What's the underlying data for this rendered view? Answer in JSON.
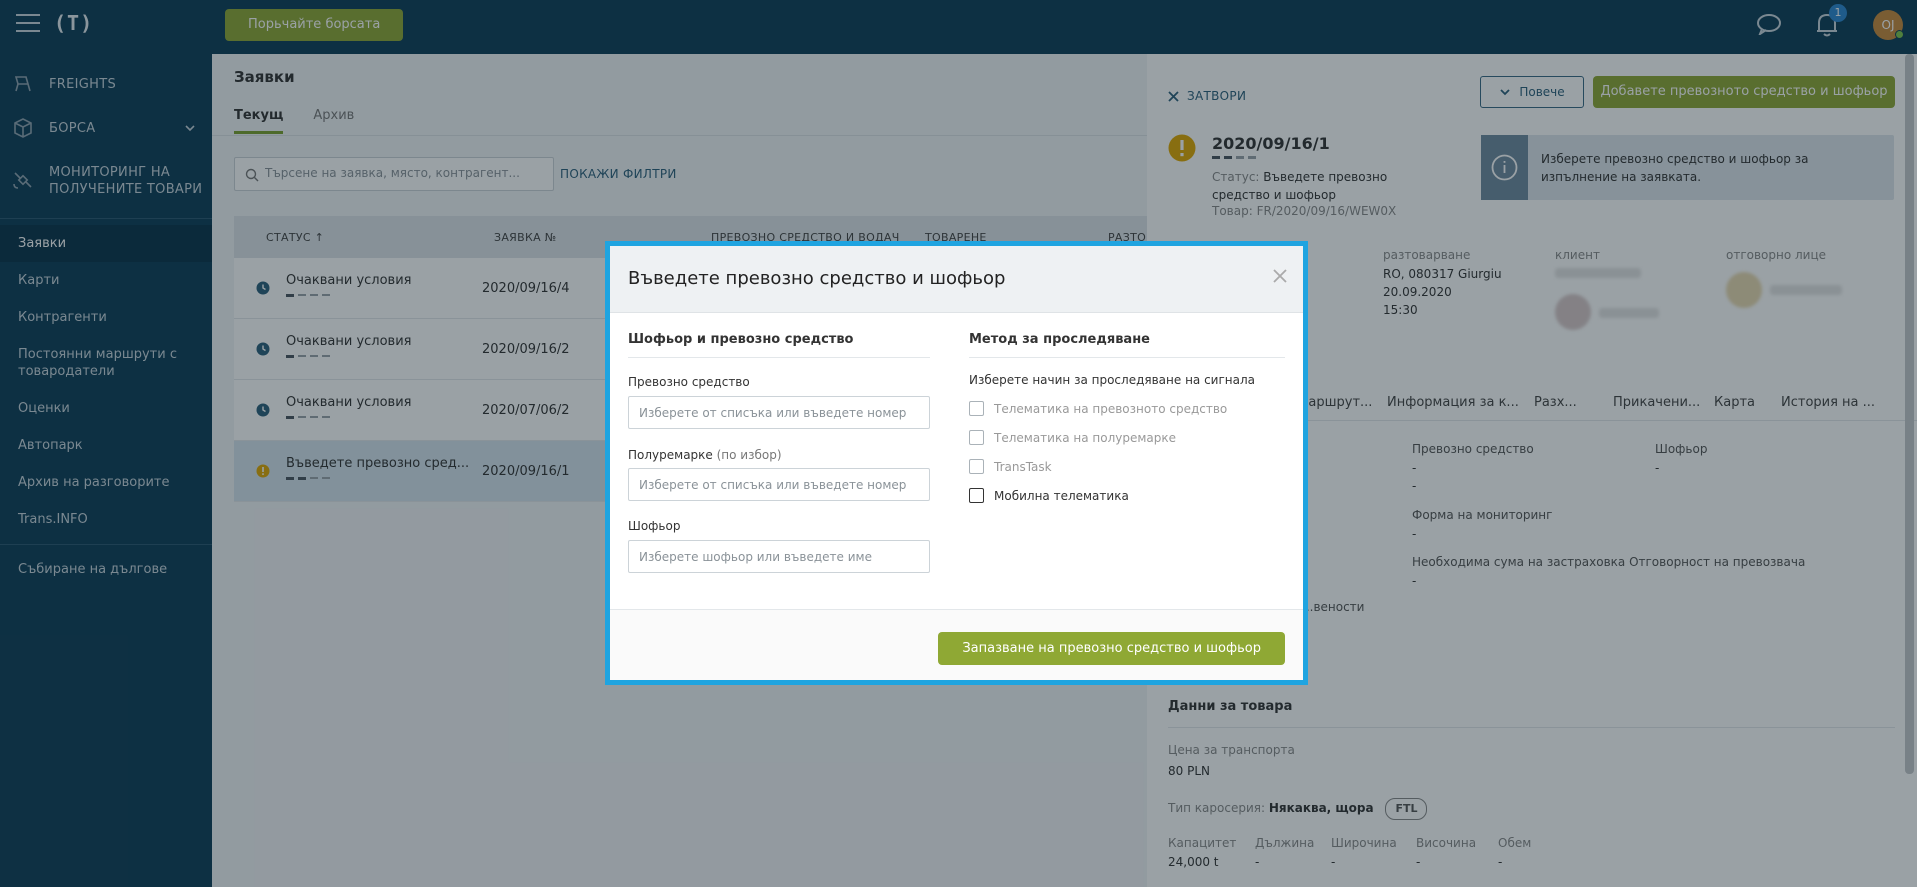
{
  "topbar": {
    "logo": "(T)",
    "browse_button": "Порьчайте борсата",
    "notifications_count": "1",
    "avatar_initials": "OJ"
  },
  "sidebar": {
    "sections": [
      {
        "label": "FREIGHTS",
        "icon": "freights-icon"
      },
      {
        "label": "БОРСА",
        "icon": "box-icon"
      },
      {
        "label": "МОНИТОРИНГ НА ПОЛУЧЕНИТЕ ТОВАРИ",
        "icon": "satellite-icon"
      }
    ],
    "items": [
      {
        "label": "Заявки",
        "active": true
      },
      {
        "label": "Карти"
      },
      {
        "label": "Контрагенти"
      },
      {
        "label": "Постоянни маршрути с товародатели"
      },
      {
        "label": "Оценки"
      },
      {
        "label": "Автопарк"
      },
      {
        "label": "Архив на разговорите"
      },
      {
        "label": "Trans.INFO"
      },
      {
        "label": "Събиране на дългове"
      }
    ]
  },
  "main": {
    "title": "Заявки",
    "tabs": [
      {
        "label": "Текущ"
      },
      {
        "label": "Архив"
      }
    ],
    "search_placeholder": "Търсене на заявка, място, контрагент...",
    "filters_label": "ПОКАЖИ ФИЛТРИ",
    "columns": [
      "СТАТУС ↑",
      "ЗАЯВКА №",
      "ПРЕВОЗНО СРЕДСТВО И ВОДАЧ",
      "ТОВАРЕНЕ",
      "РАЗТОВ"
    ],
    "rows": [
      {
        "status": "Очаквани условия",
        "number": "2020/09/16/4"
      },
      {
        "status": "Очаквани условия",
        "number": "2020/09/16/2"
      },
      {
        "status": "Очаквани условия",
        "number": "2020/07/06/2"
      },
      {
        "status": "Въведете превозно сред...",
        "number": "2020/09/16/1"
      }
    ]
  },
  "panel": {
    "close_label": "ЗАТВОРИ",
    "more_label": "Повече",
    "add_button": "Добавете превозното средство и шофьор",
    "order_number": "2020/09/16/1",
    "status_label": "Статус:",
    "status_value": "Въведете превозно средство и шофьор",
    "goods_label": "Товар:",
    "goods_value": "FR/2020/09/16/WEW0X",
    "info_text": "Изберете превозно средство и шофьор за изпълнение на заявката.",
    "unloading_label": "разтоварване",
    "unloading_place": "RO, 080317 Giurgiu",
    "unloading_date": "20.09.2020",
    "unloading_time": "15:30",
    "client_label": "клиент",
    "responsible_label": "отговорно лице",
    "tabs": [
      "...аршрут...",
      "Информация за к...",
      "Разх...",
      "Прикачени...",
      "Карта",
      "История на ..."
    ],
    "vehicle_label": "Превозно средство",
    "vehicle_value": "-",
    "vehicle_value2": "-",
    "driver_label": "Шофьор",
    "driver_value": "-",
    "monitoring_label": "Форма на мониторинг",
    "monitoring_value": "-",
    "insurance_label": "Необходима сума на застраховка Отговорност на превозвача",
    "insurance_value": "-",
    "partial_label": "...вености",
    "goods_section": "Данни за товара",
    "price_label": "Цена за транспорта",
    "price_value": "80 PLN",
    "body_label": "Тип каросерия:",
    "body_value": "Някаква, щора",
    "ftl": "FTL",
    "dims": [
      {
        "label": "Капацитет",
        "value": "24,000 t"
      },
      {
        "label": "Дължина",
        "value": "-"
      },
      {
        "label": "Широчина",
        "value": "-"
      },
      {
        "label": "Височина",
        "value": "-"
      },
      {
        "label": "Обем",
        "value": "-"
      }
    ]
  },
  "modal": {
    "title": "Въведете превозно средство и шофьор",
    "left_title": "Шофьор и превозно средство",
    "vehicle_label": "Превозно средство",
    "vehicle_placeholder": "Изберете от списъка или въведете номер",
    "trailer_label": "Полуремарке",
    "trailer_optional": "(по избор)",
    "trailer_placeholder": "Изберете от списъка или въведете номер",
    "driver_label": "Шофьор",
    "driver_placeholder": "Изберете шофьор или въведете име",
    "right_title": "Метод за проследяване",
    "right_subtitle": "Изберете начин за проследяване на сигнала",
    "options": [
      {
        "label": "Телематика на превозното средство",
        "enabled": false
      },
      {
        "label": "Телематика на полуремарке",
        "enabled": false
      },
      {
        "label": "TransTask",
        "enabled": false
      },
      {
        "label": "Мобилна телематика",
        "enabled": true
      }
    ],
    "save_button": "Запазване на превозно средство и шофьор"
  },
  "colors": {
    "navy": "#0d3d56",
    "green_button": "#8fa834",
    "modal_border": "#1fa4e0",
    "warning": "#e0a800"
  }
}
